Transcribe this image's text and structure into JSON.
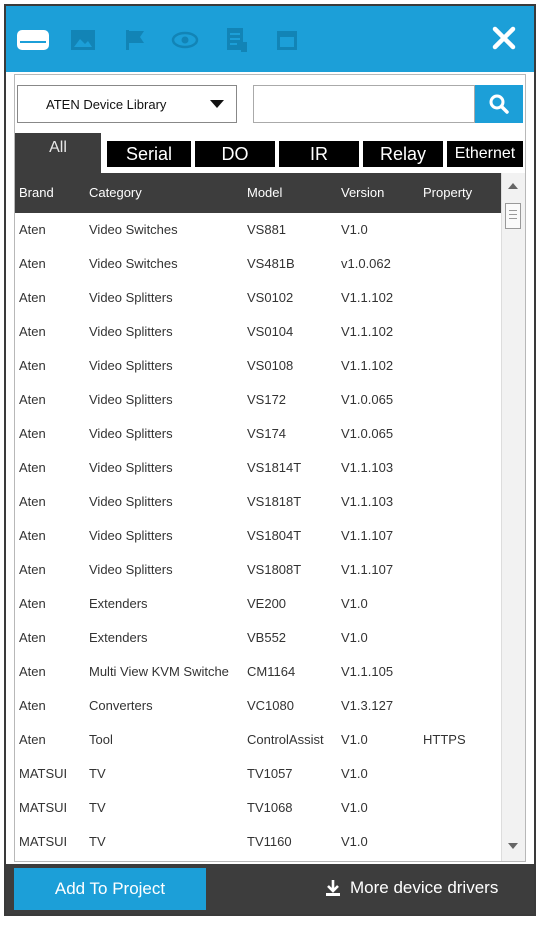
{
  "toolbar": {
    "icons": [
      "device-icon",
      "image-icon",
      "flag-icon",
      "eye-icon",
      "document-icon",
      "calendar-icon",
      "close-icon"
    ]
  },
  "library": {
    "selected": "ATEN Device Library",
    "search_placeholder": ""
  },
  "tabs": [
    {
      "label": "All"
    },
    {
      "label": "Serial"
    },
    {
      "label": "DO"
    },
    {
      "label": "IR"
    },
    {
      "label": "Relay"
    },
    {
      "label": "Ethernet"
    }
  ],
  "columns": [
    "Brand",
    "Category",
    "Model",
    "Version",
    "Property"
  ],
  "rows": [
    {
      "brand": "Aten",
      "category": "Video Switches",
      "model": "VS881",
      "version": "V1.0",
      "property": ""
    },
    {
      "brand": "Aten",
      "category": "Video Switches",
      "model": "VS481B",
      "version": "v1.0.062",
      "property": ""
    },
    {
      "brand": "Aten",
      "category": "Video Splitters",
      "model": "VS0102",
      "version": "V1.1.102",
      "property": ""
    },
    {
      "brand": "Aten",
      "category": "Video Splitters",
      "model": "VS0104",
      "version": "V1.1.102",
      "property": ""
    },
    {
      "brand": "Aten",
      "category": "Video Splitters",
      "model": "VS0108",
      "version": "V1.1.102",
      "property": ""
    },
    {
      "brand": "Aten",
      "category": "Video Splitters",
      "model": "VS172",
      "version": "V1.0.065",
      "property": ""
    },
    {
      "brand": "Aten",
      "category": "Video Splitters",
      "model": "VS174",
      "version": "V1.0.065",
      "property": ""
    },
    {
      "brand": "Aten",
      "category": "Video Splitters",
      "model": "VS1814T",
      "version": "V1.1.103",
      "property": ""
    },
    {
      "brand": "Aten",
      "category": "Video Splitters",
      "model": "VS1818T",
      "version": "V1.1.103",
      "property": ""
    },
    {
      "brand": "Aten",
      "category": "Video Splitters",
      "model": "VS1804T",
      "version": "V1.1.107",
      "property": ""
    },
    {
      "brand": "Aten",
      "category": "Video Splitters",
      "model": "VS1808T",
      "version": "V1.1.107",
      "property": ""
    },
    {
      "brand": "Aten",
      "category": "Extenders",
      "model": "VE200",
      "version": "V1.0",
      "property": ""
    },
    {
      "brand": "Aten",
      "category": "Extenders",
      "model": "VB552",
      "version": "V1.0",
      "property": ""
    },
    {
      "brand": "Aten",
      "category": "Multi View KVM Switche",
      "model": "CM1164",
      "version": "V1.1.105",
      "property": ""
    },
    {
      "brand": "Aten",
      "category": "Converters",
      "model": "VC1080",
      "version": "V1.3.127",
      "property": ""
    },
    {
      "brand": "Aten",
      "category": "Tool",
      "model": "ControlAssist",
      "version": "V1.0",
      "property": "HTTPS"
    },
    {
      "brand": "MATSUI",
      "category": "TV",
      "model": "TV1057",
      "version": "V1.0",
      "property": ""
    },
    {
      "brand": "MATSUI",
      "category": "TV",
      "model": "TV1068",
      "version": "V1.0",
      "property": ""
    },
    {
      "brand": "MATSUI",
      "category": "TV",
      "model": "TV1160",
      "version": "V1.0",
      "property": ""
    }
  ],
  "footer": {
    "add_label": "Add To Project",
    "more_label": "More device drivers"
  },
  "colors": {
    "accent": "#1c9fd8",
    "dark": "#3d3d3d"
  }
}
